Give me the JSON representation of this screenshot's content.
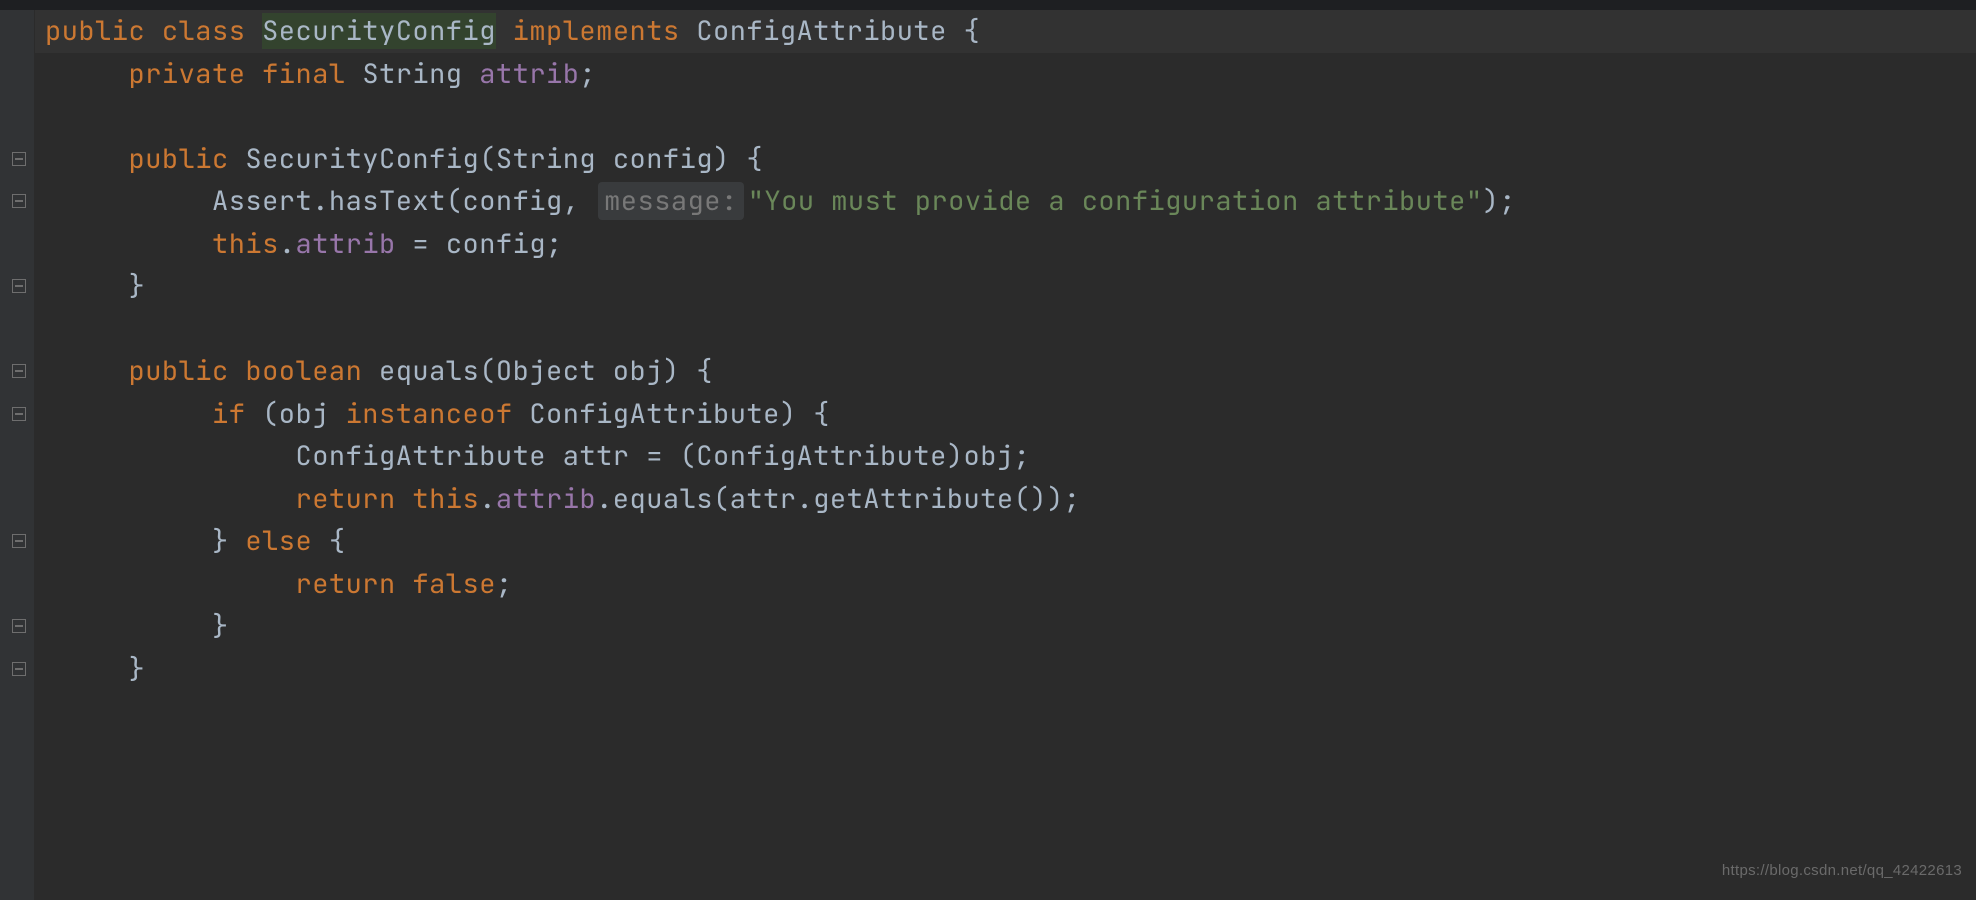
{
  "code": {
    "lines": [
      {
        "indent": 0,
        "tokens": [
          {
            "t": "public ",
            "c": "kw"
          },
          {
            "t": "class ",
            "c": "kw"
          },
          {
            "t": "SecurityConfig",
            "c": "cls",
            "hl": "classname"
          },
          {
            "t": " ",
            "c": "cls"
          },
          {
            "t": "implements ",
            "c": "kw"
          },
          {
            "t": "ConfigAttribute {",
            "c": "cls"
          }
        ],
        "highlighted": true
      },
      {
        "indent": 1,
        "tokens": [
          {
            "t": "private final ",
            "c": "kw"
          },
          {
            "t": "String ",
            "c": "cls"
          },
          {
            "t": "attrib",
            "c": "fld"
          },
          {
            "t": ";",
            "c": "cls"
          }
        ]
      },
      {
        "indent": 0,
        "tokens": []
      },
      {
        "indent": 1,
        "tokens": [
          {
            "t": "public ",
            "c": "kw"
          },
          {
            "t": "SecurityConfig",
            "c": "cls"
          },
          {
            "t": "(String config) {",
            "c": "cls"
          }
        ]
      },
      {
        "indent": 2,
        "tokens": [
          {
            "t": "Assert.hasText(config, ",
            "c": "cls"
          },
          {
            "t": "message:",
            "c": "hint"
          },
          {
            "t": "\"You must provide a configuration attribute\"",
            "c": "str"
          },
          {
            "t": ");",
            "c": "cls"
          }
        ]
      },
      {
        "indent": 2,
        "tokens": [
          {
            "t": "this",
            "c": "kw"
          },
          {
            "t": ".",
            "c": "cls"
          },
          {
            "t": "attrib",
            "c": "fld"
          },
          {
            "t": " = config;",
            "c": "cls"
          }
        ]
      },
      {
        "indent": 1,
        "tokens": [
          {
            "t": "}",
            "c": "cls"
          }
        ]
      },
      {
        "indent": 0,
        "tokens": []
      },
      {
        "indent": 1,
        "tokens": [
          {
            "t": "public boolean ",
            "c": "kw"
          },
          {
            "t": "equals(Object obj) {",
            "c": "cls"
          }
        ]
      },
      {
        "indent": 2,
        "tokens": [
          {
            "t": "if ",
            "c": "kw"
          },
          {
            "t": "(obj ",
            "c": "cls"
          },
          {
            "t": "instanceof ",
            "c": "kw"
          },
          {
            "t": "ConfigAttribute) {",
            "c": "cls"
          }
        ]
      },
      {
        "indent": 3,
        "tokens": [
          {
            "t": "ConfigAttribute attr = (ConfigAttribute)obj;",
            "c": "cls"
          }
        ]
      },
      {
        "indent": 3,
        "tokens": [
          {
            "t": "return this",
            "c": "kw"
          },
          {
            "t": ".",
            "c": "cls"
          },
          {
            "t": "attrib",
            "c": "fld"
          },
          {
            "t": ".equals(attr.getAttribute());",
            "c": "cls"
          }
        ]
      },
      {
        "indent": 2,
        "tokens": [
          {
            "t": "} ",
            "c": "cls"
          },
          {
            "t": "else ",
            "c": "kw"
          },
          {
            "t": "{",
            "c": "cls"
          }
        ]
      },
      {
        "indent": 3,
        "tokens": [
          {
            "t": "return false",
            "c": "kw"
          },
          {
            "t": ";",
            "c": "cls"
          }
        ]
      },
      {
        "indent": 2,
        "tokens": [
          {
            "t": "}",
            "c": "cls"
          }
        ]
      },
      {
        "indent": 1,
        "tokens": [
          {
            "t": "}",
            "c": "cls"
          }
        ]
      }
    ]
  },
  "foldMarkers": [
    {
      "line": 3
    },
    {
      "line": 4
    },
    {
      "line": 6
    },
    {
      "line": 8
    },
    {
      "line": 9
    },
    {
      "line": 12
    },
    {
      "line": 14
    },
    {
      "line": 15
    }
  ],
  "watermark": "https://blog.csdn.net/qq_42422613"
}
